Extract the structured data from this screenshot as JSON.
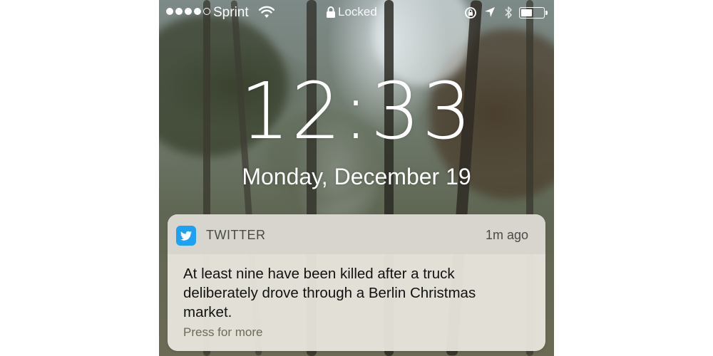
{
  "status_bar": {
    "signal": {
      "filled": 4,
      "total": 5
    },
    "carrier": "Sprint",
    "wifi_icon": "wifi-icon",
    "lock_label": "Locked",
    "lock_icon": "lock-icon",
    "rotation_lock_icon": "rotation-lock-icon",
    "location_icon": "location-arrow-icon",
    "bluetooth_icon": "bluetooth-icon",
    "battery_level": 0.5
  },
  "lock_screen": {
    "time": "12:33",
    "date": "Monday, December 19"
  },
  "notification": {
    "app_icon": "twitter-bird-icon",
    "app_icon_color": "#1da1f2",
    "app_name": "TWITTER",
    "time_ago": "1m ago",
    "body": "At least nine have been killed after a truck deliberately drove through a Berlin Christmas market.",
    "footer": "Press for more"
  }
}
